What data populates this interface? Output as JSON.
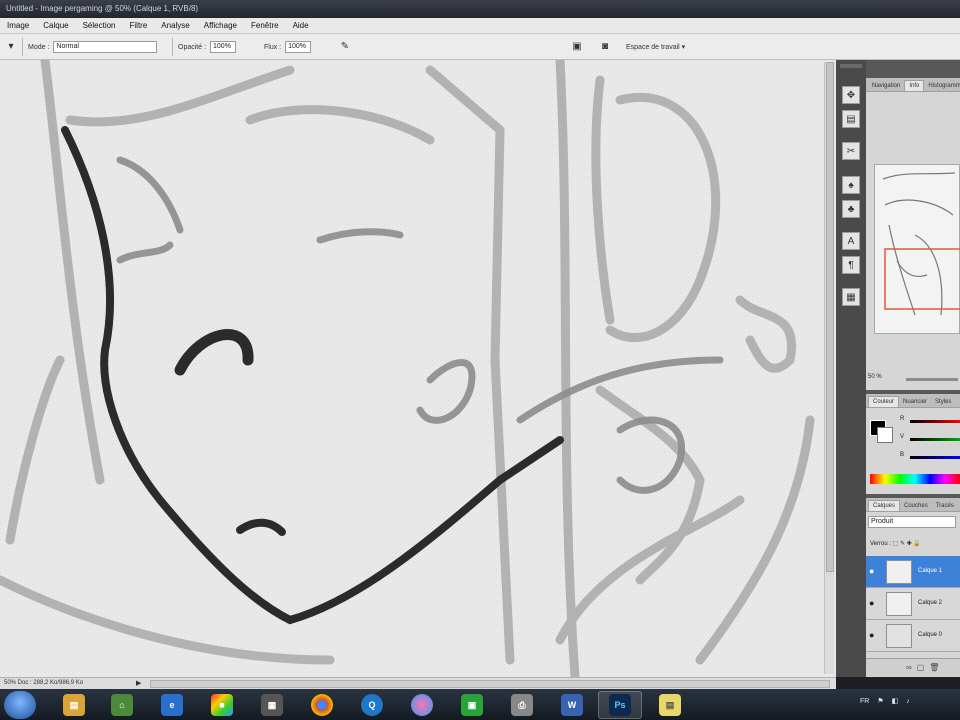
{
  "window": {
    "title": "Untitled - Image pergaming @ 50% (Calque 1, RVB/8)"
  },
  "menu": [
    "Image",
    "Calque",
    "Sélection",
    "Filtre",
    "Analyse",
    "Affichage",
    "Fenêtre",
    "Aide"
  ],
  "options": {
    "mode_label": "Mode :",
    "mode_value": "Normal",
    "opacity_label": "Opacité :",
    "opacity_value": "100%",
    "flow_label": "Flux :",
    "flow_value": "100%",
    "workspace_label": "Espace de travail ▾"
  },
  "status": {
    "zoom_text": "50% Doc : 288,2 Ko/986,9 Ko"
  },
  "navigator": {
    "tabs": [
      "Navigation",
      "Info",
      "Histogramme"
    ],
    "zoom": "50 %"
  },
  "color_panel": {
    "tabs": [
      "Couleur",
      "Nuancier",
      "Styles"
    ],
    "channels": [
      "R",
      "V",
      "B"
    ],
    "values": [
      "0",
      "0",
      "0"
    ]
  },
  "layers_panel": {
    "tabs": [
      "Calques",
      "Couches",
      "Tracés"
    ],
    "blend_mode": "Produit",
    "lock_text": "Verrou : ⬚ ✎ ✚ 🔒",
    "layers": [
      {
        "name": "Calque 1",
        "active": true
      },
      {
        "name": "Calque 2",
        "active": false
      },
      {
        "name": "Calque 0",
        "active": false
      }
    ]
  },
  "taskbar": {
    "apps": [
      "explorer-icon",
      "network-icon",
      "ie-icon",
      "paint-icon",
      "qr-icon",
      "chrome-icon",
      "search-icon",
      "media-icon",
      "green-app-icon",
      "printer-icon",
      "word-icon",
      "photoshop-icon",
      "notes-icon"
    ],
    "active_app": "Ps",
    "tray_text": "FR"
  },
  "colors": {
    "accent": "#3d82d8",
    "canvas": "#e7e7e7",
    "panel_dark": "#4a4a4a"
  }
}
